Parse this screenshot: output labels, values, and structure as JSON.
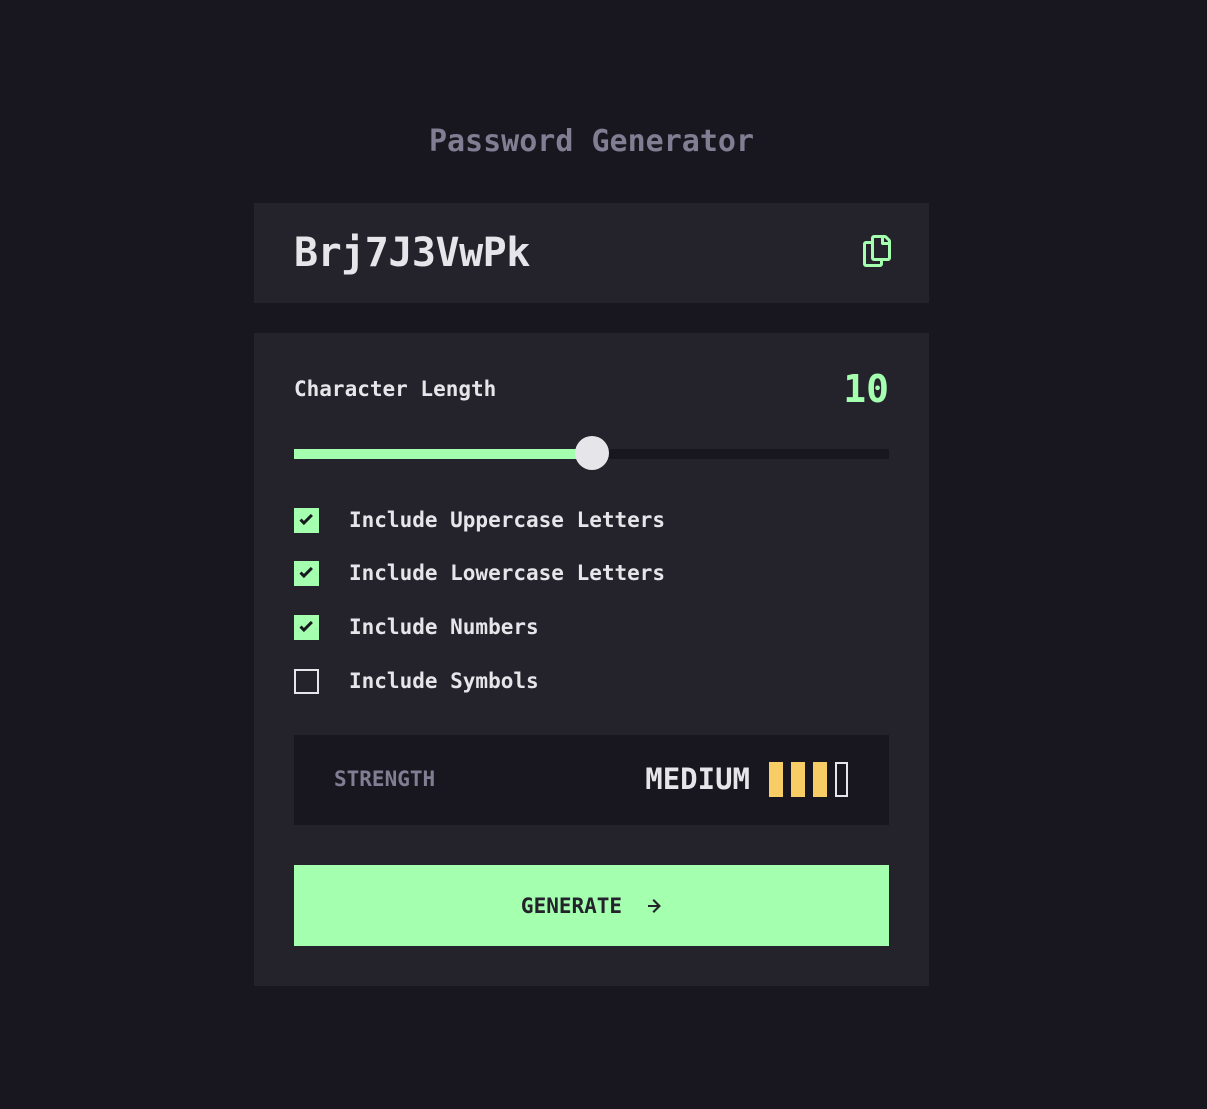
{
  "header": {
    "title": "Password Generator"
  },
  "password": {
    "value": "Brj7J3VwPk",
    "copy_icon": "copy-icon"
  },
  "length": {
    "label": "Character Length",
    "value": "10",
    "slider_fraction": 0.5
  },
  "options": [
    {
      "label": "Include Uppercase Letters",
      "checked": true
    },
    {
      "label": "Include Lowercase Letters",
      "checked": true
    },
    {
      "label": "Include Numbers",
      "checked": true
    },
    {
      "label": "Include Symbols",
      "checked": false
    }
  ],
  "strength": {
    "label": "STRENGTH",
    "value": "MEDIUM",
    "level": 3,
    "max": 4
  },
  "generate": {
    "label": "GENERATE",
    "icon": "arrow-right-icon"
  },
  "colors": {
    "background": "#18171f",
    "panel": "#24232c",
    "accent": "#a4ffaf",
    "muted": "#817d92",
    "strength_medium": "#f8cd65",
    "text": "#e6e5ea"
  }
}
